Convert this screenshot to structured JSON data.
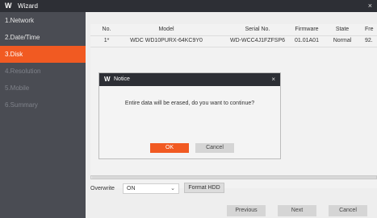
{
  "window": {
    "logo": "W",
    "title": "Wizard",
    "close": "×"
  },
  "sidebar": {
    "items": [
      {
        "label": "1.Network"
      },
      {
        "label": "2.Date/Time"
      },
      {
        "label": "3.Disk"
      },
      {
        "label": "4.Resolution"
      },
      {
        "label": "5.Mobile"
      },
      {
        "label": "6.Summary"
      }
    ],
    "active_index": 2
  },
  "disk_table": {
    "headers": [
      "No.",
      "Model",
      "Serial No.",
      "Firmware",
      "State",
      "Fre"
    ],
    "rows": [
      {
        "no": "1*",
        "model": "WDC WD10PURX-64KC9Y0",
        "serial": "WD-WCC4J1FZFSP6",
        "firmware": "01.01A01",
        "state": "Normal",
        "free": "92."
      }
    ]
  },
  "overwrite": {
    "label": "Overwrite",
    "value": "ON",
    "chevron": "⌄"
  },
  "format_button": "Format HDD",
  "footer": {
    "previous": "Previous",
    "next": "Next",
    "cancel": "Cancel"
  },
  "dialog": {
    "logo": "W",
    "title": "Notice",
    "close": "×",
    "message": "Entire data will be erased, do you want to continue?",
    "ok": "OK",
    "cancel": "Cancel"
  },
  "colors": {
    "accent": "#f15a22",
    "titlebar": "#2d2f35",
    "sidebar": "#4a4c53"
  }
}
